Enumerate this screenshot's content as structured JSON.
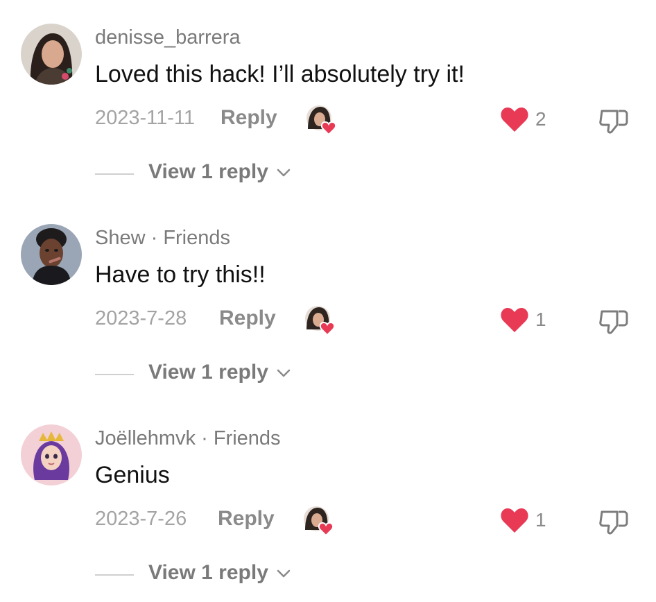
{
  "colors": {
    "heart": "#e83a55",
    "meta_gray": "#a3a3a3",
    "text": "#111111"
  },
  "comments": [
    {
      "username": "denisse_barrera",
      "text": "Loved this hack! I’ll absolutely try it!",
      "date": "2023-11-11",
      "reply_label": "Reply",
      "likes": "2",
      "view_replies": "View 1 reply"
    },
    {
      "username": "Shew · Friends",
      "text": "Have to try this!!",
      "date": "2023-7-28",
      "reply_label": "Reply",
      "likes": "1",
      "view_replies": "View 1 reply"
    },
    {
      "username": "Joëllehmvk · Friends",
      "text": "Genius",
      "date": "2023-7-26",
      "reply_label": "Reply",
      "likes": "1",
      "view_replies": "View 1 reply"
    }
  ],
  "icons": {
    "avatar": "avatar",
    "creator_liked": "creator-liked-icon",
    "like": "heart-icon",
    "dislike": "thumbs-down-icon",
    "expand": "chevron-down-icon"
  }
}
